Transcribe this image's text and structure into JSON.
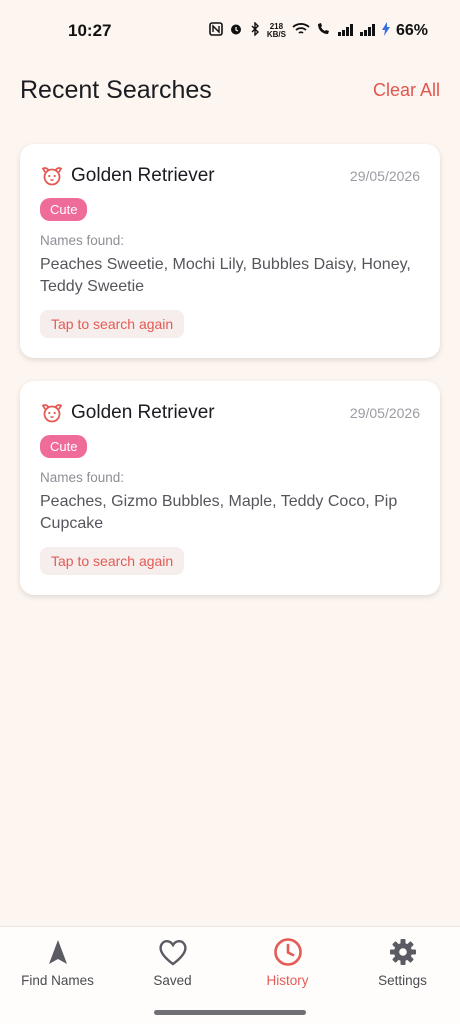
{
  "status_bar": {
    "time": "10:27",
    "speed_top": "218",
    "speed_bottom": "KB/S",
    "battery": "66%"
  },
  "header": {
    "title": "Recent Searches",
    "clear_all": "Clear All"
  },
  "cards": [
    {
      "title": "Golden Retriever",
      "date": "29/05/2026",
      "tag": "Cute",
      "names_label": "Names found:",
      "names": "Peaches Sweetie, Mochi Lily, Bubbles Daisy, Honey, Teddy Sweetie",
      "action": "Tap to search again"
    },
    {
      "title": "Golden Retriever",
      "date": "29/05/2026",
      "tag": "Cute",
      "names_label": "Names found:",
      "names": "Peaches, Gizmo Bubbles, Maple, Teddy Coco, Pip Cupcake",
      "action": "Tap to search again"
    }
  ],
  "nav": {
    "items": [
      {
        "label": "Find Names",
        "icon": "navigation-arrow-icon"
      },
      {
        "label": "Saved",
        "icon": "heart-icon"
      },
      {
        "label": "History",
        "icon": "clock-icon",
        "active": true
      },
      {
        "label": "Settings",
        "icon": "gear-icon"
      }
    ]
  },
  "colors": {
    "accent": "#e45a55",
    "tag": "#ef6b9a",
    "background": "#fdf5ef"
  }
}
